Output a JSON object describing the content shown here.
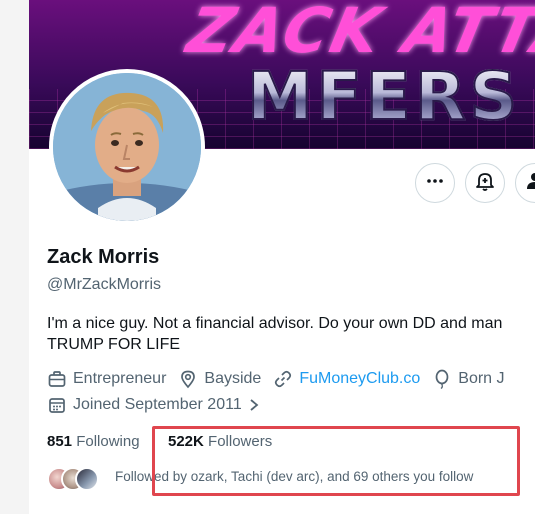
{
  "banner": {
    "top_text": "ZACK ATTAC",
    "main_text": "MFERS"
  },
  "profile": {
    "name": "Zack Morris",
    "handle": "@MrZackMorris",
    "bio_line1": "I'm a nice guy. Not a financial advisor. Do your own DD and man",
    "bio_line2": "TRUMP FOR LIFE",
    "occupation": "Entrepreneur",
    "location": "Bayside",
    "website": "FuMoneyClub.co",
    "born": "Born J",
    "joined": "Joined September 2011"
  },
  "stats": {
    "following_count": "851",
    "following_label": "Following",
    "followers_count": "522K",
    "followers_label": "Followers"
  },
  "followed_by": "Followed by ozark, Tachi (dev arc), and 69 others you follow",
  "icons": {
    "more": "more-icon",
    "notify": "bell-plus-icon",
    "follow": "person-icon"
  },
  "colors": {
    "link": "#1d9bf0",
    "highlight": "#e0464e",
    "text_secondary": "#536471"
  }
}
